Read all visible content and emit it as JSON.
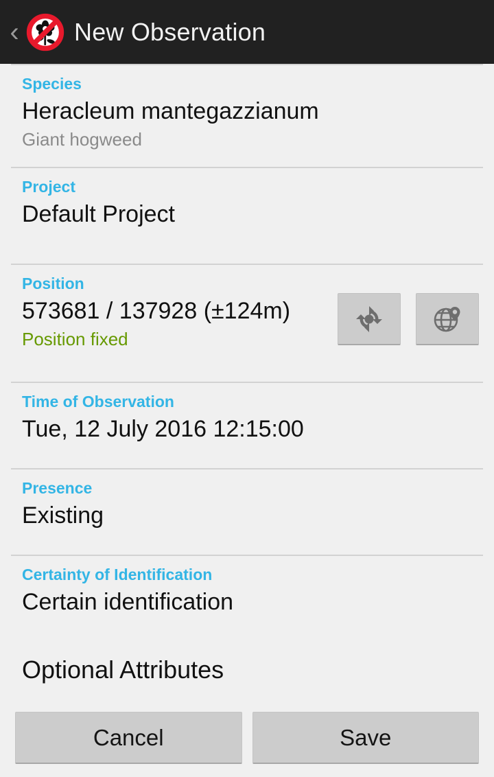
{
  "header": {
    "back_label": "‹",
    "icon_name": "no-invasive-plant-icon",
    "title": "New Observation"
  },
  "sections": {
    "species": {
      "label": "Species",
      "value": "Heracleum mantegazzianum",
      "common_name": "Giant hogweed"
    },
    "project": {
      "label": "Project",
      "value": "Default Project"
    },
    "position": {
      "label": "Position",
      "value": "573681 / 137928 (±124m)",
      "status": "Position fixed",
      "status_color": "#669900",
      "gps_button_name": "refresh-gps-icon",
      "map_button_name": "globe-pin-icon"
    },
    "time": {
      "label": "Time of Observation",
      "value": "Tue, 12 July 2016 12:15:00"
    },
    "presence": {
      "label": "Presence",
      "value": "Existing"
    },
    "certainty": {
      "label": "Certainty of Identification",
      "value": "Certain identification"
    },
    "optional": {
      "label": "Optional Attributes"
    }
  },
  "buttons": {
    "cancel": "Cancel",
    "save": "Save"
  },
  "colors": {
    "accent": "#33b5e5",
    "action_bar": "#212121",
    "background": "#f0f0f0",
    "status_green": "#669900",
    "button_face": "#cccccc"
  }
}
